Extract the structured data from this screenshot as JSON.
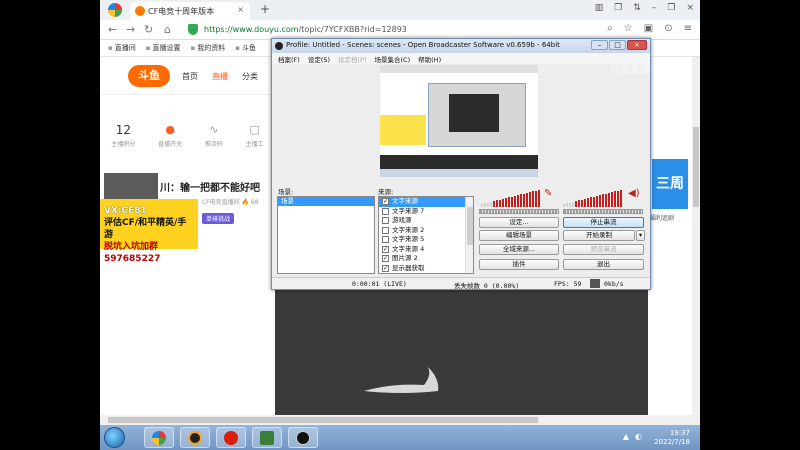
{
  "browser": {
    "tab_title": "CF电竞十周年版本",
    "tab_close": "×",
    "new_tab": "+",
    "url_main": "https://www.douyu.com",
    "url_path": "/topic/7YCFXBB?rid=12893",
    "window_controls": [
      "▥",
      "❐",
      "⇅",
      "–",
      "❐",
      "×"
    ],
    "nav_icons": [
      "⌕",
      "☆",
      "▣",
      "⊙",
      "≡"
    ],
    "bookmarks": [
      "直播间",
      "直播设置",
      "我的资料",
      "斗鱼"
    ]
  },
  "site": {
    "logo_text": "斗鱼",
    "nav": [
      "首页",
      "直播",
      "分类"
    ],
    "stats": [
      {
        "value": "12",
        "label": "主播积分"
      },
      {
        "icon": "●",
        "label": "直播开关"
      },
      {
        "icon": "∿",
        "label": "推流码"
      },
      {
        "icon": "▢",
        "label": "主播工"
      }
    ],
    "stream_title": "川：输一把都不能好吧",
    "streamer": "CF电竞直播间 🔥 68",
    "stream_tag": "单排挑战",
    "promo_lines": [
      "VX:CF81",
      "评估CF/和平精英/手游",
      "脱坑入坑加群597685227"
    ],
    "right_promo": "三周",
    "right_caption": "福利追剧"
  },
  "obs": {
    "title": "Profile: Untitled - Scenes: scenes - Open Broadcaster Software v0.659b - 64bit",
    "menu": [
      "档案(F)",
      "设定(S)",
      "设定档(P)",
      "场景集合(C)",
      "帮助(H)"
    ],
    "menu_disabled": [
      false,
      false,
      true,
      false,
      false
    ],
    "scenes_label": "场景:",
    "sources_label": "来源:",
    "scenes": [
      "场景"
    ],
    "sources": [
      {
        "name": "文字来源",
        "checked": true,
        "selected": true
      },
      {
        "name": "文字来源 7",
        "checked": false
      },
      {
        "name": "游戏源",
        "checked": false
      },
      {
        "name": "文字来源 2",
        "checked": false
      },
      {
        "name": "文字来源 5",
        "checked": false
      },
      {
        "name": "文字来源 4",
        "checked": true
      },
      {
        "name": "图片源 2",
        "checked": true
      },
      {
        "name": "显示器获取",
        "checked": true
      }
    ],
    "buttons": {
      "settings": "设定...",
      "stop_stream": "停止串流",
      "edit_scene": "编辑场景",
      "start_record": "开始录制",
      "global_sources": "全域来源...",
      "preview_stream": "预览串流",
      "plugins": "插件",
      "exit": "退出"
    },
    "status": {
      "time": "0:00:01 (LIVE)",
      "dropped": "丢失帧数 0 (0.00%)",
      "fps": "FPS: 59",
      "kbps": "0kb/s"
    },
    "watermark": "斗鱼直播"
  },
  "taskbar": {
    "time": "19:37",
    "date": "2022/7/18",
    "tray_icons": [
      "▲",
      "◐"
    ]
  }
}
